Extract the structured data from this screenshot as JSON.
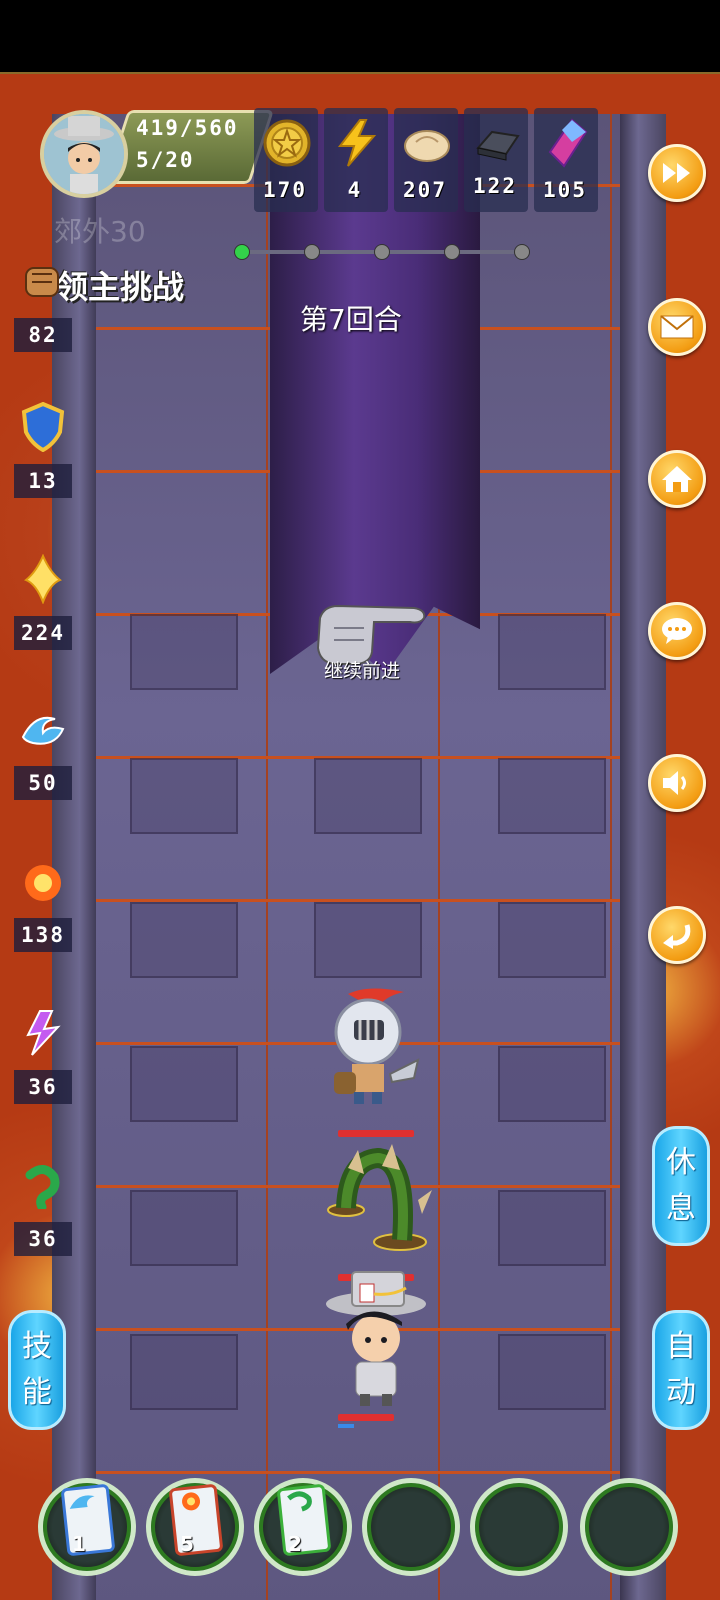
{
  "player": {
    "hp": "419/560",
    "stamina": "5/20"
  },
  "resources": [
    {
      "icon": "gold-coin-icon",
      "value": "170"
    },
    {
      "icon": "lightning-icon",
      "value": "4"
    },
    {
      "icon": "bun-icon",
      "value": "207"
    },
    {
      "icon": "iron-ingot-icon",
      "value": "122"
    },
    {
      "icon": "crystal-icon",
      "value": "105"
    }
  ],
  "stage": {
    "title": "领主挑战",
    "round": "第7回合",
    "faded_overlay": "郊外30",
    "progress_current_index": 0,
    "progress_total": 5
  },
  "skills": [
    {
      "icon": "fist-icon",
      "value": "82"
    },
    {
      "icon": "shield-icon",
      "value": "13"
    },
    {
      "icon": "holy-light-icon",
      "value": "224"
    },
    {
      "icon": "water-wave-icon",
      "value": "50"
    },
    {
      "icon": "fire-icon",
      "value": "138"
    },
    {
      "icon": "lightning-bolt-icon",
      "value": "36"
    },
    {
      "icon": "poison-worm-icon",
      "value": "36"
    }
  ],
  "side_buttons": [
    {
      "icon": "fast-forward-icon"
    },
    {
      "icon": "mail-icon"
    },
    {
      "icon": "home-icon"
    },
    {
      "icon": "chat-icon"
    },
    {
      "icon": "sound-icon"
    },
    {
      "icon": "return-icon"
    }
  ],
  "actions": {
    "continue": "继续前进",
    "rest": [
      "休",
      "息"
    ],
    "auto": [
      "自",
      "动"
    ],
    "skill": [
      "技",
      "能"
    ]
  },
  "cards": [
    {
      "count": "1",
      "color": "#3a78d8",
      "icon": "water-card-icon"
    },
    {
      "count": "5",
      "color": "#c8442a",
      "icon": "fire-card-icon"
    },
    {
      "count": "2",
      "color": "#3bb03a",
      "icon": "poison-card-icon"
    }
  ]
}
